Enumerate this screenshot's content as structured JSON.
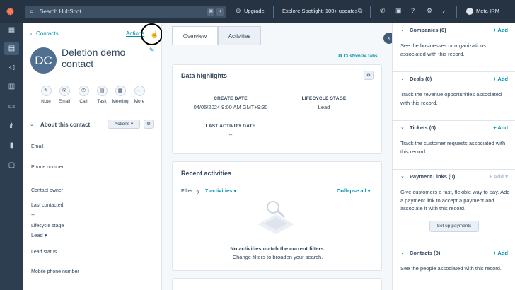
{
  "topbar": {
    "logo": "✺",
    "search_placeholder": "Search HubSpot",
    "kbd1": "⌘",
    "kbd2": "K",
    "upgrade": "Upgrade",
    "spotlight": "Explore Spotlight: 100+ updates",
    "account": "Meta-IRM"
  },
  "record": {
    "back": "Contacts",
    "actions": "Actions",
    "initials": "DC",
    "name": "Deletion demo contact",
    "buttons": [
      "Note",
      "Email",
      "Call",
      "Task",
      "Meeting",
      "More"
    ],
    "about_title": "About this contact",
    "about_actions": "Actions",
    "fields": {
      "email": "Email",
      "phone": "Phone number",
      "owner": "Contact owner",
      "last_contacted": "Last contacted",
      "last_contacted_val": "--",
      "lifecycle": "Lifecycle stage",
      "lifecycle_val": "Lead",
      "lead_status": "Lead status",
      "mobile": "Mobile phone number"
    }
  },
  "center": {
    "tab_overview": "Overview",
    "tab_activities": "Activities",
    "customize": "Customize tabs",
    "highlights_title": "Data highlights",
    "create_date_label": "CREATE DATE",
    "create_date_val": "04/05/2024 9:00 AM GMT+9:30",
    "lifecycle_label": "LIFECYCLE STAGE",
    "lifecycle_val": "Lead",
    "last_activity_label": "LAST ACTIVITY DATE",
    "last_activity_val": "--",
    "recent_title": "Recent activities",
    "filter_by": "Filter by:",
    "filter_val": "7 activities",
    "collapse_all": "Collapse all",
    "empty_title": "No activities match the current filters.",
    "empty_sub": "Change filters to broaden your search."
  },
  "right": {
    "companies": "Companies (0)",
    "companies_desc": "See the businesses or organizations associated with this record.",
    "deals": "Deals (0)",
    "deals_desc": "Track the revenue opportunities associated with this record.",
    "tickets": "Tickets (0)",
    "tickets_desc": "Track the customer requests associated with this record.",
    "payment_links": "Payment Links (0)",
    "payment_desc": "Give customers a fast, flexible way to pay. Add a payment link to accept a payment and associate it with this record.",
    "setup_payments": "Set up payments",
    "contacts": "Contacts (0)",
    "contacts_desc": "See the people associated with this record.",
    "add": "+ Add"
  }
}
